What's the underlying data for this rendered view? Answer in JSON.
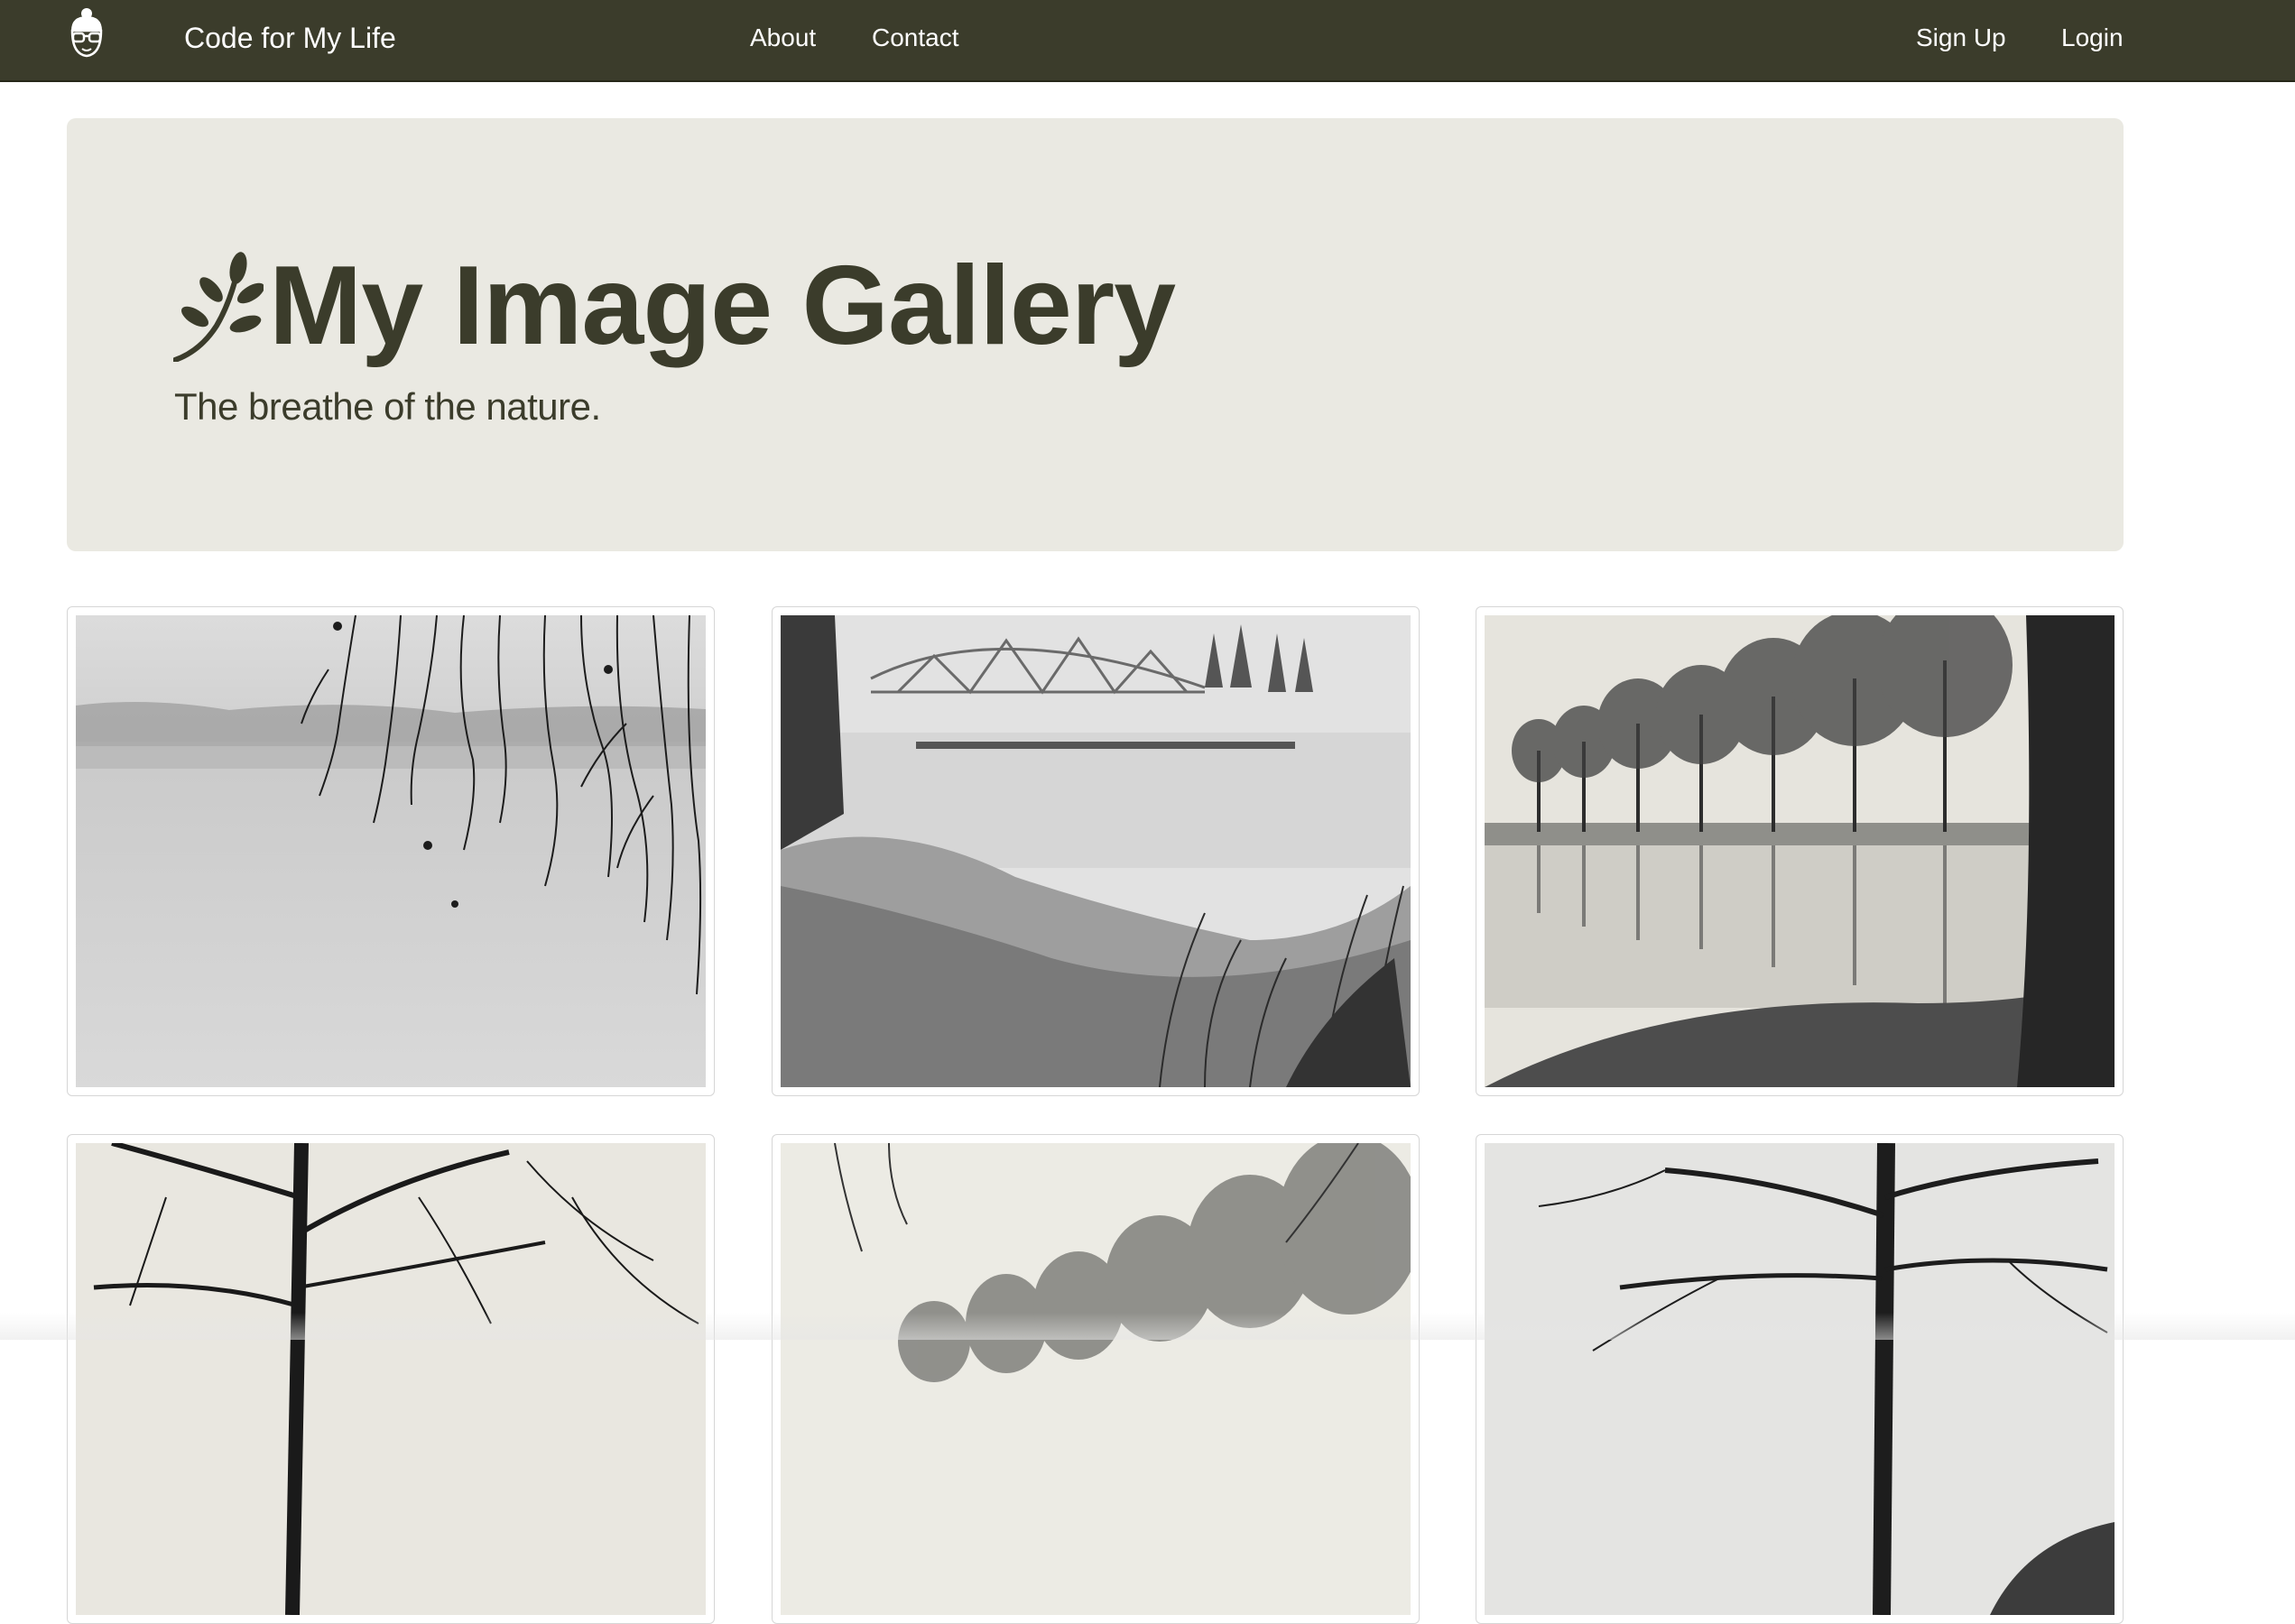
{
  "navbar": {
    "logo_icon": "person-with-glasses-icon",
    "brand": "Code for My Life",
    "links": {
      "about": "About",
      "contact": "Contact",
      "signup": "Sign Up",
      "login": "Login"
    }
  },
  "hero": {
    "icon": "leaf-icon",
    "title": "My Image Gallery",
    "subtitle": "The breathe of the nature."
  },
  "gallery": [
    {
      "icon": "photo-misty-lake-with-branches"
    },
    {
      "icon": "photo-river-bridge-with-grass"
    },
    {
      "icon": "photo-tree-lined-canal-reflection"
    },
    {
      "icon": "photo-bare-tree-branches"
    },
    {
      "icon": "photo-misty-tree-row"
    },
    {
      "icon": "photo-large-bare-tree"
    }
  ],
  "colors": {
    "navbar_bg": "#3b3c2b",
    "hero_bg": "#eae9e2",
    "title_text": "#3b3c2b",
    "nav_text": "#ffffff"
  }
}
